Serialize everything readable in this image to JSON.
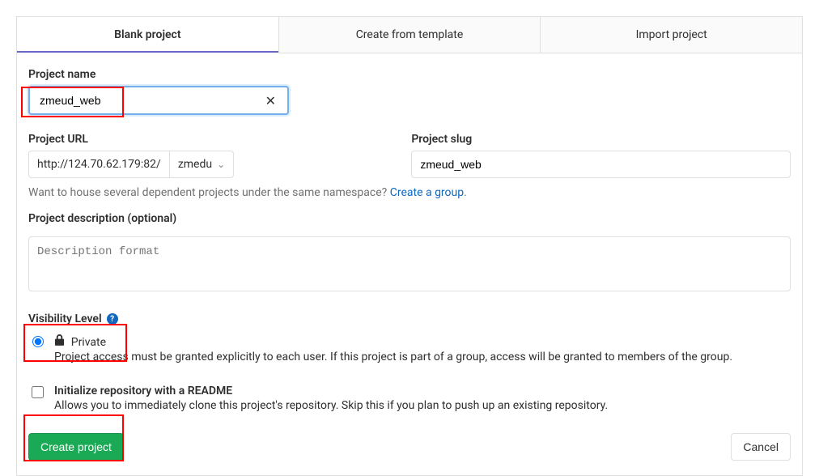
{
  "tabs": {
    "blank": "Blank project",
    "template": "Create from template",
    "import": "Import project"
  },
  "projectName": {
    "label": "Project name",
    "value": "zmeud_web"
  },
  "projectUrl": {
    "label": "Project URL",
    "base": "http://124.70.62.179:82/",
    "namespace": "zmedu"
  },
  "projectSlug": {
    "label": "Project slug",
    "value": "zmeud_web"
  },
  "namespaceHint": {
    "text": "Want to house several dependent projects under the same namespace? ",
    "linkText": "Create a group",
    "suffix": "."
  },
  "description": {
    "label": "Project description (optional)",
    "placeholder": "Description format"
  },
  "visibility": {
    "label": "Visibility Level",
    "private": {
      "title": "Private",
      "desc": "Project access must be granted explicitly to each user. If this project is part of a group, access will be granted to members of the group."
    }
  },
  "initReadme": {
    "title": "Initialize repository with a README",
    "desc": "Allows you to immediately clone this project's repository. Skip this if you plan to push up an existing repository."
  },
  "buttons": {
    "create": "Create project",
    "cancel": "Cancel"
  }
}
